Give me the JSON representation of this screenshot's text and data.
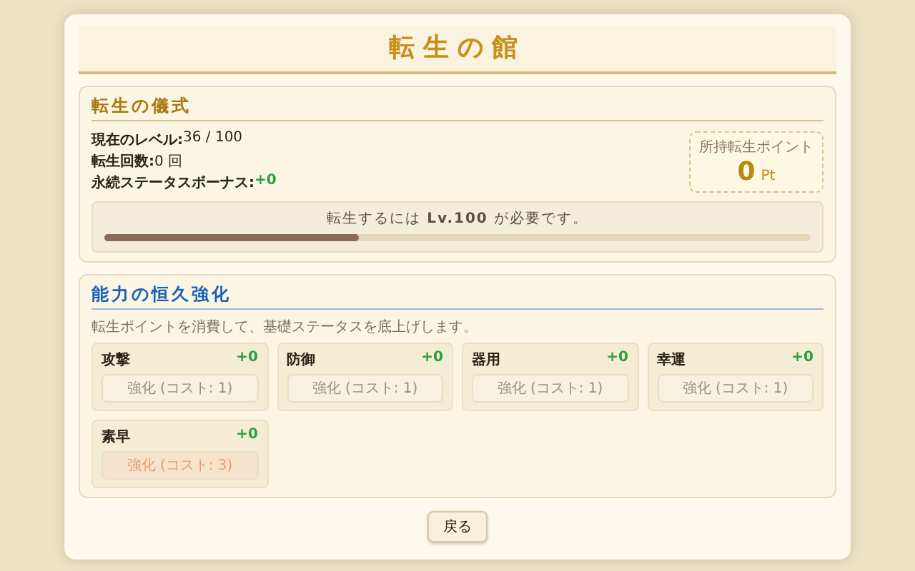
{
  "title": "転生の館",
  "ritual": {
    "heading": "転生の儀式",
    "stats": [
      {
        "label": "現在のレベル:",
        "value": "36 / 100",
        "kind": "plain"
      },
      {
        "label": "転生回数:",
        "value": "0 回",
        "kind": "plain"
      },
      {
        "label": "永続ステータスボーナス:",
        "value": "+0",
        "kind": "bonus"
      }
    ],
    "points": {
      "label": "所持転生ポイント",
      "value": "0",
      "unit": "Pt"
    },
    "requirement": "転生するには **Lv.100** が必要です。",
    "level": 0.36
  },
  "upgrade": {
    "heading": "能力の恒久強化",
    "description": "転生ポイントを消費して、基礎ステータスを底上げします。",
    "items": [
      {
        "name": "攻撃",
        "bonus": "+0",
        "button": "強化 (コスト: 1)",
        "kind": "normal",
        "disabled": true
      },
      {
        "name": "防御",
        "bonus": "+0",
        "button": "強化 (コスト: 1)",
        "kind": "normal",
        "disabled": true
      },
      {
        "name": "器用",
        "bonus": "+0",
        "button": "強化 (コスト: 1)",
        "kind": "normal",
        "disabled": true
      },
      {
        "name": "幸運",
        "bonus": "+0",
        "button": "強化 (コスト: 1)",
        "kind": "normal",
        "disabled": true
      },
      {
        "name": "素早",
        "bonus": "+0",
        "button": "強化 (コスト: 3)",
        "kind": "costly",
        "disabled": true
      }
    ]
  },
  "back_button": "戻る"
}
